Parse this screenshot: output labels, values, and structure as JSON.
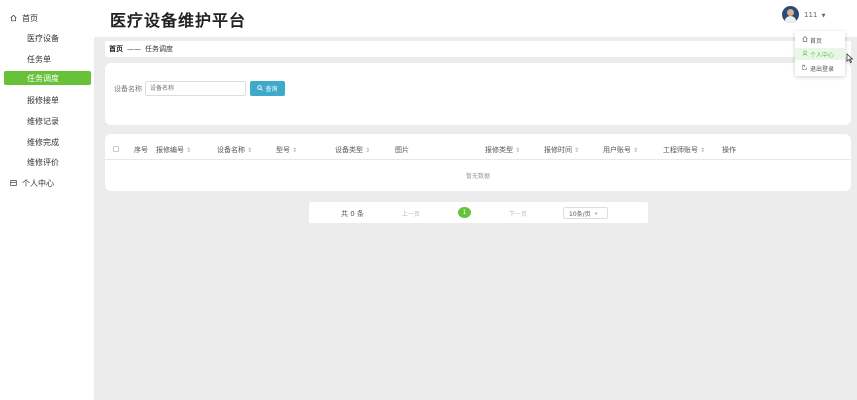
{
  "app": {
    "title": "医疗设备维护平台"
  },
  "sidebar": {
    "items": [
      {
        "label": "首页",
        "icon": "home-icon"
      },
      {
        "label": "医疗设备",
        "icon": "grid-icon"
      },
      {
        "label": "任务单",
        "icon": "grid-icon"
      },
      {
        "label": "任务调度",
        "icon": "grid-icon",
        "active": true
      },
      {
        "label": "报修接单",
        "icon": "grid-icon"
      },
      {
        "label": "维修记录",
        "icon": "grid-icon"
      },
      {
        "label": "维修完成",
        "icon": "grid-icon"
      },
      {
        "label": "维修评价",
        "icon": "grid-icon"
      },
      {
        "label": "个人中心",
        "icon": "document-icon"
      }
    ]
  },
  "header": {
    "user_name": "111",
    "dropdown": {
      "items": [
        {
          "label": "首页",
          "icon": "home-icon"
        },
        {
          "label": "个人中心",
          "icon": "user-icon"
        },
        {
          "label": "退出登录",
          "icon": "logout-icon"
        }
      ]
    }
  },
  "breadcrumb": {
    "home": "首页",
    "separator": "——",
    "current": "任务调度"
  },
  "search": {
    "label": "设备名称",
    "placeholder": "设备名称",
    "value": "",
    "button": "查询"
  },
  "table": {
    "columns": [
      "序号",
      "报修编号",
      "设备名称",
      "型号",
      "设备类型",
      "图片",
      "报修类型",
      "报修时间",
      "用户账号",
      "工程师账号",
      "操作"
    ],
    "empty_text": "暂无数据",
    "rows": []
  },
  "pagination": {
    "total": "共 0 条",
    "prev": "上一页",
    "page": "1",
    "next": "下一页",
    "page_size": "10条/页"
  },
  "colors": {
    "accent": "#67c23a",
    "search_button": "#3fa9c9"
  }
}
